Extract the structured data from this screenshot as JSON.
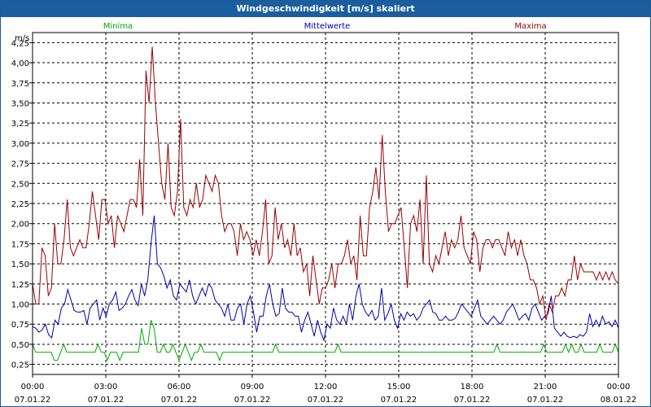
{
  "window": {
    "title": "Windgeschwindigkeit [m/s] skaliert"
  },
  "chart_data": {
    "type": "line",
    "title": "Windgeschwindigkeit [m/s] skaliert",
    "ylabel": "m/s",
    "xlabel": "",
    "ylim": [
      0.125,
      4.375
    ],
    "xlim": [
      0,
      24
    ],
    "grid": true,
    "y_ticks": [
      "0,25",
      "0,50",
      "0,75",
      "1,00",
      "1,25",
      "1,50",
      "1,75",
      "2,00",
      "2,25",
      "2,50",
      "2,75",
      "3,00",
      "3,25",
      "3,50",
      "3,75",
      "4,00",
      "4,25"
    ],
    "x_ticks": [
      {
        "time": "00:00",
        "date": "07.01.22"
      },
      {
        "time": "03:00",
        "date": "07.01.22"
      },
      {
        "time": "06:00",
        "date": "07.01.22"
      },
      {
        "time": "09:00",
        "date": "07.01.22"
      },
      {
        "time": "12:00",
        "date": "07.01.22"
      },
      {
        "time": "15:00",
        "date": "07.01.22"
      },
      {
        "time": "18:00",
        "date": "07.01.22"
      },
      {
        "time": "21:00",
        "date": "07.01.22"
      },
      {
        "time": "00:00",
        "date": "08.01.22"
      }
    ],
    "series": [
      {
        "name": "Minima",
        "color": "#00aa00",
        "values": [
          0.5,
          0.4,
          0.4,
          0.4,
          0.4,
          0.4,
          0.4,
          0.3,
          0.3,
          0.4,
          0.5,
          0.4,
          0.4,
          0.4,
          0.4,
          0.4,
          0.4,
          0.4,
          0.4,
          0.4,
          0.4,
          0.5,
          0.4,
          0.4,
          0.3,
          0.4,
          0.4,
          0.4,
          0.3,
          0.4,
          0.4,
          0.4,
          0.4,
          0.4,
          0.4,
          0.7,
          0.5,
          0.5,
          0.8,
          0.7,
          0.4,
          0.4,
          0.5,
          0.4,
          0.4,
          0.5,
          0.4,
          0.3,
          0.4,
          0.5,
          0.4,
          0.3,
          0.4,
          0.4,
          0.5,
          0.4,
          0.4,
          0.4,
          0.4,
          0.4,
          0.3,
          0.4,
          0.4,
          0.4,
          0.4,
          0.4,
          0.4,
          0.4,
          0.4,
          0.4,
          0.4,
          0.4,
          0.4,
          0.4,
          0.4,
          0.4,
          0.4,
          0.4,
          0.5,
          0.4,
          0.4,
          0.4,
          0.4,
          0.4,
          0.4,
          0.4,
          0.4,
          0.4,
          0.4,
          0.4,
          0.4,
          0.4,
          0.4,
          0.4,
          0.4,
          0.4,
          0.4,
          0.4,
          0.5,
          0.4,
          0.4,
          0.4,
          0.4,
          0.4,
          0.4,
          0.4,
          0.4,
          0.4,
          0.4,
          0.4,
          0.4,
          0.4,
          0.4,
          0.4,
          0.4,
          0.4,
          0.4,
          0.4,
          0.4,
          0.4,
          0.4,
          0.4,
          0.4,
          0.4,
          0.4,
          0.4,
          0.4,
          0.4,
          0.4,
          0.4,
          0.4,
          0.4,
          0.4,
          0.4,
          0.4,
          0.4,
          0.4,
          0.4,
          0.4,
          0.4,
          0.4,
          0.4,
          0.4,
          0.4,
          0.4,
          0.4,
          0.4,
          0.4,
          0.4,
          0.5,
          0.4,
          0.4,
          0.4,
          0.4,
          0.4,
          0.4,
          0.4,
          0.4,
          0.4,
          0.4,
          0.4,
          0.4,
          0.4,
          0.4,
          0.5,
          0.4,
          0.4,
          0.4,
          0.4,
          0.4,
          0.4,
          0.5,
          0.4,
          0.5,
          0.4,
          0.4,
          0.5,
          0.4,
          0.4,
          0.4,
          0.4,
          0.4,
          0.5,
          0.4,
          0.4,
          0.4,
          0.4,
          0.5,
          0.4
        ]
      },
      {
        "name": "Mittelwerte",
        "color": "#0000aa",
        "values": [
          0.72,
          0.7,
          0.65,
          0.68,
          0.75,
          0.62,
          0.58,
          0.8,
          0.75,
          0.95,
          1.0,
          1.18,
          1.05,
          0.92,
          0.9,
          0.9,
          0.92,
          0.75,
          0.95,
          1.0,
          1.05,
          0.8,
          0.95,
          0.85,
          1.0,
          1.05,
          1.15,
          0.92,
          0.95,
          1.0,
          1.1,
          1.18,
          1.05,
          0.98,
          1.25,
          1.1,
          1.3,
          1.75,
          2.1,
          1.5,
          1.45,
          1.35,
          1.2,
          1.3,
          1.1,
          1.05,
          1.25,
          1.2,
          1.15,
          1.3,
          1.1,
          1.0,
          1.1,
          1.2,
          1.1,
          1.25,
          1.2,
          1.05,
          1.0,
          0.95,
          0.85,
          1.0,
          0.8,
          0.8,
          0.95,
          1.0,
          0.75,
          1.0,
          1.1,
          0.9,
          0.65,
          0.85,
          0.85,
          1.1,
          1.25,
          1.0,
          0.85,
          0.88,
          1.2,
          0.95,
          0.9,
          0.9,
          0.85,
          0.85,
          0.65,
          0.8,
          0.9,
          0.75,
          0.6,
          0.8,
          0.65,
          0.55,
          0.75,
          0.7,
          0.95,
          0.8,
          0.75,
          0.85,
          0.75,
          1.0,
          0.8,
          1.1,
          1.25,
          1.0,
          0.9,
          0.85,
          0.92,
          0.8,
          0.85,
          1.2,
          0.8,
          0.88,
          1.0,
          0.8,
          0.7,
          0.88,
          0.8,
          0.9,
          0.85,
          0.88,
          0.8,
          0.85,
          0.95,
          1.0,
          1.05,
          0.9,
          0.88,
          0.8,
          0.8,
          0.85,
          0.8,
          0.8,
          0.82,
          0.9,
          1.0,
          0.95,
          0.9,
          0.85,
          0.95,
          1.05,
          0.85,
          0.8,
          0.75,
          0.8,
          0.85,
          0.8,
          0.75,
          0.8,
          0.9,
          0.95,
          1.0,
          0.9,
          0.8,
          0.85,
          0.88,
          0.8,
          0.95,
          1.0,
          0.9,
          0.8,
          0.85,
          0.88,
          1.1,
          0.7,
          0.65,
          0.6,
          0.65,
          0.6,
          0.58,
          0.6,
          0.58,
          0.62,
          0.6,
          0.65,
          0.88,
          0.72,
          0.8,
          0.72,
          0.85,
          0.75,
          0.78,
          0.72,
          0.8,
          0.7
        ]
      },
      {
        "name": "Maxima",
        "color": "#990000",
        "values": [
          1.25,
          1.0,
          1.0,
          1.7,
          1.6,
          1.1,
          1.2,
          2.0,
          1.5,
          1.5,
          1.8,
          2.3,
          1.7,
          1.6,
          1.7,
          1.8,
          1.7,
          1.7,
          2.0,
          2.4,
          2.1,
          1.8,
          2.3,
          2.3,
          2.0,
          2.1,
          1.7,
          2.1,
          2.0,
          1.9,
          2.1,
          2.3,
          2.3,
          2.2,
          2.8,
          2.1,
          3.9,
          3.5,
          4.2,
          3.5,
          3.0,
          2.5,
          2.3,
          3.0,
          2.2,
          2.1,
          2.4,
          3.3,
          2.2,
          2.1,
          2.3,
          2.2,
          2.5,
          2.2,
          2.3,
          2.6,
          2.5,
          2.4,
          2.6,
          2.5,
          2.1,
          1.9,
          2.0,
          2.0,
          1.9,
          1.6,
          2.0,
          1.8,
          1.9,
          1.8,
          1.6,
          1.8,
          1.6,
          1.9,
          2.3,
          1.5,
          1.6,
          2.2,
          1.8,
          2.0,
          1.7,
          1.8,
          1.6,
          2.0,
          1.6,
          1.7,
          1.4,
          1.5,
          1.1,
          1.6,
          1.3,
          1.0,
          1.2,
          1.2,
          1.3,
          1.5,
          1.2,
          1.5,
          1.5,
          1.6,
          1.8,
          1.5,
          1.6,
          1.3,
          2.1,
          1.6,
          1.6,
          2.2,
          2.4,
          2.7,
          2.3,
          3.1,
          2.4,
          1.9,
          2.0,
          2.0,
          2.1,
          2.2,
          1.7,
          1.2,
          2.0,
          2.1,
          1.9,
          2.3,
          1.5,
          2.6,
          1.5,
          1.4,
          1.6,
          1.5,
          1.7,
          1.9,
          1.6,
          1.8,
          1.7,
          1.8,
          2.1,
          1.7,
          1.6,
          1.5,
          1.9,
          1.8,
          1.4,
          1.7,
          1.8,
          1.8,
          1.7,
          1.8,
          1.8,
          1.7,
          1.6,
          1.9,
          1.7,
          1.8,
          1.6,
          1.8,
          1.6,
          1.5,
          1.3,
          1.3,
          1.2,
          1.0,
          1.1,
          0.8,
          1.0,
          0.9,
          1.1,
          1.1,
          1.2,
          1.1,
          1.3,
          1.3,
          1.6,
          1.3,
          1.5,
          1.4,
          1.4,
          1.4,
          1.4,
          1.3,
          1.4,
          1.3,
          1.4,
          1.3,
          1.4,
          1.3,
          1.25
        ]
      }
    ]
  }
}
